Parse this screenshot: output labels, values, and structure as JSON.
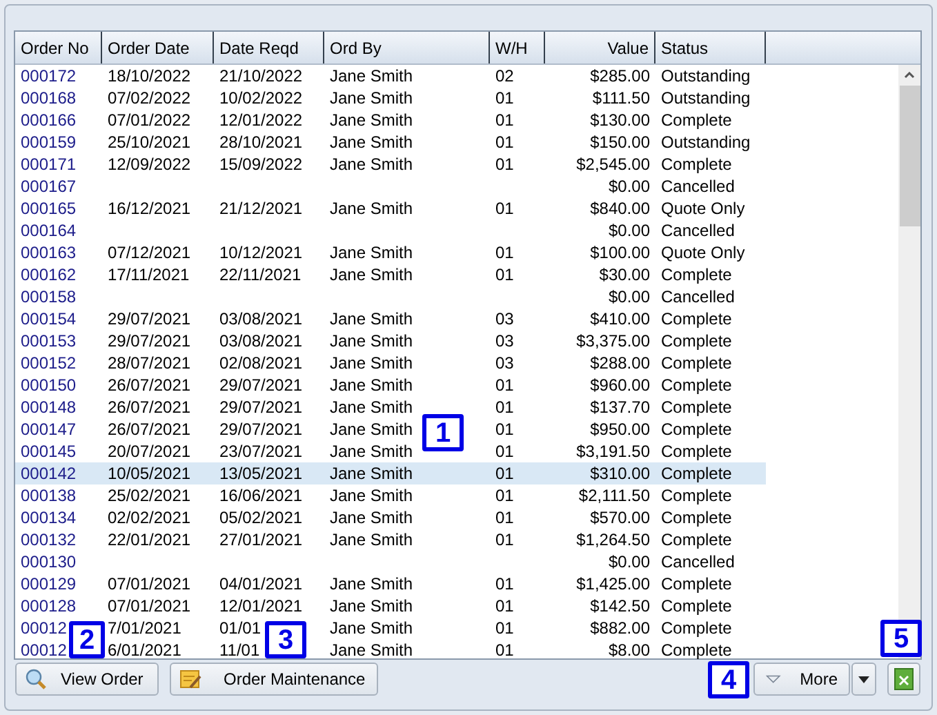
{
  "table": {
    "columns": [
      "Order No",
      "Order Date",
      "Date Reqd",
      "Ord By",
      "W/H",
      "Value",
      "Status"
    ],
    "rows": [
      {
        "order_no": "000172",
        "order_date": "18/10/2022",
        "date_reqd": "21/10/2022",
        "ord_by": "Jane Smith",
        "wh": "02",
        "value": "$285.00",
        "status": "Outstanding",
        "selected": false
      },
      {
        "order_no": "000168",
        "order_date": "07/02/2022",
        "date_reqd": "10/02/2022",
        "ord_by": "Jane Smith",
        "wh": "01",
        "value": "$111.50",
        "status": "Outstanding",
        "selected": false
      },
      {
        "order_no": "000166",
        "order_date": "07/01/2022",
        "date_reqd": "12/01/2022",
        "ord_by": "Jane Smith",
        "wh": "01",
        "value": "$130.00",
        "status": "Complete",
        "selected": false
      },
      {
        "order_no": "000159",
        "order_date": "25/10/2021",
        "date_reqd": "28/10/2021",
        "ord_by": "Jane Smith",
        "wh": "01",
        "value": "$150.00",
        "status": "Outstanding",
        "selected": false
      },
      {
        "order_no": "000171",
        "order_date": "12/09/2022",
        "date_reqd": "15/09/2022",
        "ord_by": "Jane Smith",
        "wh": "01",
        "value": "$2,545.00",
        "status": "Complete",
        "selected": false
      },
      {
        "order_no": "000167",
        "value": "$0.00",
        "status": "Cancelled",
        "selected": false
      },
      {
        "order_no": "000165",
        "order_date": "16/12/2021",
        "date_reqd": "21/12/2021",
        "ord_by": "Jane Smith",
        "wh": "01",
        "value": "$840.00",
        "status": "Quote Only",
        "selected": false
      },
      {
        "order_no": "000164",
        "value": "$0.00",
        "status": "Cancelled",
        "selected": false
      },
      {
        "order_no": "000163",
        "order_date": "07/12/2021",
        "date_reqd": "10/12/2021",
        "ord_by": "Jane Smith",
        "wh": "01",
        "value": "$100.00",
        "status": "Quote Only",
        "selected": false
      },
      {
        "order_no": "000162",
        "order_date": "17/11/2021",
        "date_reqd": "22/11/2021",
        "ord_by": "Jane Smith",
        "wh": "01",
        "value": "$30.00",
        "status": "Complete",
        "selected": false
      },
      {
        "order_no": "000158",
        "value": "$0.00",
        "status": "Cancelled",
        "selected": false
      },
      {
        "order_no": "000154",
        "order_date": "29/07/2021",
        "date_reqd": "03/08/2021",
        "ord_by": "Jane Smith",
        "wh": "03",
        "value": "$410.00",
        "status": "Complete",
        "selected": false
      },
      {
        "order_no": "000153",
        "order_date": "29/07/2021",
        "date_reqd": "03/08/2021",
        "ord_by": "Jane Smith",
        "wh": "03",
        "value": "$3,375.00",
        "status": "Complete",
        "selected": false
      },
      {
        "order_no": "000152",
        "order_date": "28/07/2021",
        "date_reqd": "02/08/2021",
        "ord_by": "Jane Smith",
        "wh": "03",
        "value": "$288.00",
        "status": "Complete",
        "selected": false
      },
      {
        "order_no": "000150",
        "order_date": "26/07/2021",
        "date_reqd": "29/07/2021",
        "ord_by": "Jane Smith",
        "wh": "01",
        "value": "$960.00",
        "status": "Complete",
        "selected": false
      },
      {
        "order_no": "000148",
        "order_date": "26/07/2021",
        "date_reqd": "29/07/2021",
        "ord_by": "Jane Smith",
        "wh": "01",
        "value": "$137.70",
        "status": "Complete",
        "selected": false
      },
      {
        "order_no": "000147",
        "order_date": "26/07/2021",
        "date_reqd": "29/07/2021",
        "ord_by": "Jane Smith",
        "wh": "01",
        "value": "$950.00",
        "status": "Complete",
        "selected": false
      },
      {
        "order_no": "000145",
        "order_date": "20/07/2021",
        "date_reqd": "23/07/2021",
        "ord_by": "Jane Smith",
        "wh": "01",
        "value": "$3,191.50",
        "status": "Complete",
        "selected": false
      },
      {
        "order_no": "000142",
        "order_date": "10/05/2021",
        "date_reqd": "13/05/2021",
        "ord_by": "Jane Smith",
        "wh": "01",
        "value": "$310.00",
        "status": "Complete",
        "selected": true
      },
      {
        "order_no": "000138",
        "order_date": "25/02/2021",
        "date_reqd": "16/06/2021",
        "ord_by": "Jane Smith",
        "wh": "01",
        "value": "$2,111.50",
        "status": "Complete",
        "selected": false
      },
      {
        "order_no": "000134",
        "order_date": "02/02/2021",
        "date_reqd": "05/02/2021",
        "ord_by": "Jane Smith",
        "wh": "01",
        "value": "$570.00",
        "status": "Complete",
        "selected": false
      },
      {
        "order_no": "000132",
        "order_date": "22/01/2021",
        "date_reqd": "27/01/2021",
        "ord_by": "Jane Smith",
        "wh": "01",
        "value": "$1,264.50",
        "status": "Complete",
        "selected": false
      },
      {
        "order_no": "000130",
        "value": "$0.00",
        "status": "Cancelled",
        "selected": false
      },
      {
        "order_no": "000129",
        "order_date": "07/01/2021",
        "date_reqd": "04/01/2021",
        "ord_by": "Jane Smith",
        "wh": "01",
        "value": "$1,425.00",
        "status": "Complete",
        "selected": false
      },
      {
        "order_no": "000128",
        "order_date": "07/01/2021",
        "date_reqd": "12/01/2021",
        "ord_by": "Jane Smith",
        "wh": "01",
        "value": "$142.50",
        "status": "Complete",
        "selected": false
      },
      {
        "order_no": "00012",
        "order_date": "7/01/2021",
        "date_reqd": "01/01",
        "ord_by": "Jane Smith",
        "wh": "01",
        "value": "$882.00",
        "status": "Complete",
        "selected": false
      },
      {
        "order_no": "00012",
        "order_date": "6/01/2021",
        "date_reqd": "11/01",
        "ord_by": "Jane Smith",
        "wh": "01",
        "value": "$8.00",
        "status": "Complete",
        "selected": false
      }
    ]
  },
  "buttons": {
    "view_order": "View Order",
    "order_maintenance": "Order Maintenance",
    "more": "More"
  },
  "callouts": [
    "1",
    "2",
    "3",
    "4",
    "5"
  ]
}
